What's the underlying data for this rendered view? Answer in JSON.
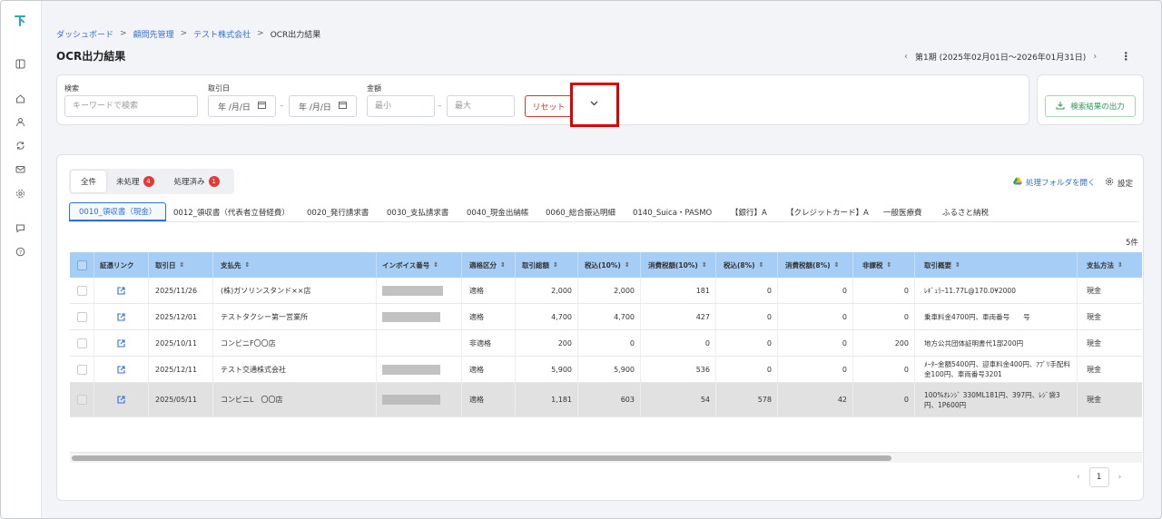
{
  "breadcrumb": {
    "items": [
      "ダッシュボード",
      "顧問先管理",
      "テスト株式会社"
    ],
    "current": "OCR出力結果"
  },
  "page_title": "OCR出力結果",
  "period": {
    "label": "第1期 (2025年02月01日～2026年01月31日)"
  },
  "sidebar": {
    "icons": [
      "logo-icon",
      "panel-icon",
      "home-icon",
      "user-icon",
      "sync-icon",
      "mail-icon",
      "gear-icon",
      "chat-icon",
      "help-icon"
    ]
  },
  "filters": {
    "search_label": "検索",
    "search_placeholder": "キーワードで検索",
    "date_label": "取引日",
    "date_from": "年 /月/日",
    "date_to": "年 /月/日",
    "amount_label": "金額",
    "amount_min_placeholder": "最小",
    "amount_max_placeholder": "最大",
    "reset_label": "リセット"
  },
  "export_label": "検索結果の出力",
  "status_tabs": [
    {
      "label": "全件",
      "badge": ""
    },
    {
      "label": "未処理",
      "badge": "4"
    },
    {
      "label": "処理済み",
      "badge": "1"
    }
  ],
  "actions": {
    "open_folder": "処理フォルダを開く",
    "settings": "設定"
  },
  "doc_tabs": [
    "0010_領収書（現金）",
    "0012_領収書（代表者立替経費）",
    "0020_発行請求書",
    "0030_支払請求書",
    "0040_現金出納帳",
    "0060_総合振込明細",
    "0140_Suica・PASMO",
    "【銀行】A",
    "【クレジットカード】A",
    "一般医療費",
    "ふるさと納税"
  ],
  "result_count": "5件",
  "table": {
    "columns": [
      "証憑リンク",
      "取引日",
      "支払先",
      "インボイス番号",
      "適格区分",
      "取引総額",
      "税込(10%)",
      "消費税額(10%)",
      "税込(8%)",
      "消費税額(8%)",
      "非課税",
      "取引概要",
      "支払方法"
    ],
    "rows": [
      {
        "date": "2025/11/26",
        "payee": "(株)ガソリンスタンド××店",
        "invoice": "",
        "qual": "適格",
        "total": "2,000",
        "tax10in": "2,000",
        "tax10": "181",
        "tax8in": "0",
        "tax8": "0",
        "nontax": "0",
        "summary": "ﾚｷﾞｭﾗｰ11.77L@170.0¥2000",
        "method": "現金"
      },
      {
        "date": "2025/12/01",
        "payee": "テストタクシー第一営業所",
        "invoice": "",
        "qual": "適格",
        "total": "4,700",
        "tax10in": "4,700",
        "tax10": "427",
        "tax8in": "0",
        "tax8": "0",
        "nontax": "0",
        "summary": "乗車料金4700円、車両番号　　号",
        "method": "現金"
      },
      {
        "date": "2025/10/11",
        "payee": "コンビニF〇〇店",
        "invoice": "",
        "qual": "非適格",
        "total": "200",
        "tax10in": "0",
        "tax10": "0",
        "tax8in": "0",
        "tax8": "0",
        "nontax": "200",
        "summary": "地方公共団体証明書代1部200円",
        "method": "現金"
      },
      {
        "date": "2025/12/11",
        "payee": "テスト交通株式会社",
        "invoice": "",
        "qual": "適格",
        "total": "5,900",
        "tax10in": "5,900",
        "tax10": "536",
        "tax8in": "0",
        "tax8": "0",
        "nontax": "0",
        "summary": "ﾒｰﾀｰ金額5400円、迎車料金400円、ｱﾌﾟﾘ手配料金100円、車両番号3201",
        "method": "現金"
      },
      {
        "date": "2025/05/11",
        "payee": "コンビニL　〇〇店",
        "invoice": "",
        "qual": "適格",
        "total": "1,181",
        "tax10in": "603",
        "tax10": "54",
        "tax8in": "578",
        "tax8": "42",
        "nontax": "0",
        "summary": "100%ｵﾚﾝｼﾞ 330ML181円、397円、ﾚｼﾞ袋3円、1P600円",
        "method": "現金"
      }
    ]
  },
  "pagination": {
    "current": "1"
  }
}
